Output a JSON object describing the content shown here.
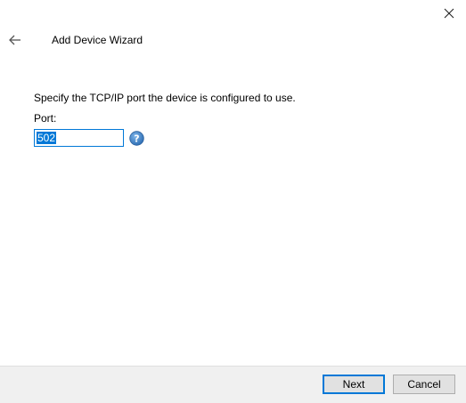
{
  "window": {
    "title": "Add Device Wizard"
  },
  "icons": {
    "close": "close-icon",
    "back": "back-arrow-icon",
    "help": "help-icon"
  },
  "colors": {
    "accent": "#0078d7",
    "footer_bg": "#f0f0f0",
    "button_bg": "#e1e1e1"
  },
  "content": {
    "instruction": "Specify the TCP/IP port the device is configured to use.",
    "port_label": "Port:",
    "port_value": "502"
  },
  "footer": {
    "next_label": "Next",
    "cancel_label": "Cancel"
  }
}
